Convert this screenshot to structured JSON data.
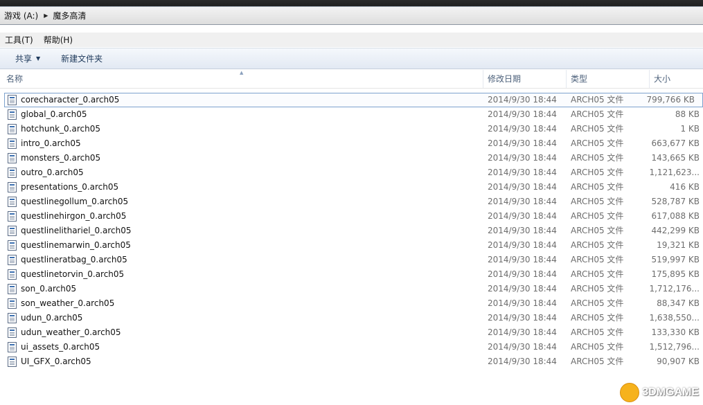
{
  "address_bar": {
    "crumbs": [
      "游戏 (A:)",
      "魔多高清"
    ],
    "separator": "▶"
  },
  "menu": {
    "items": [
      "工具(T)",
      "帮助(H)"
    ]
  },
  "toolbar": {
    "share_label": "共享",
    "share_caret": "▼",
    "new_folder_label": "新建文件夹"
  },
  "columns": {
    "name": "名称",
    "date": "修改日期",
    "type": "类型",
    "size": "大小",
    "sort_arrow": "▲"
  },
  "files": [
    {
      "name": "corecharacter_0.arch05",
      "date": "2014/9/30 18:44",
      "type": "ARCH05 文件",
      "size": "799,766 KB"
    },
    {
      "name": "global_0.arch05",
      "date": "2014/9/30 18:44",
      "type": "ARCH05 文件",
      "size": "88 KB"
    },
    {
      "name": "hotchunk_0.arch05",
      "date": "2014/9/30 18:44",
      "type": "ARCH05 文件",
      "size": "1 KB"
    },
    {
      "name": "intro_0.arch05",
      "date": "2014/9/30 18:44",
      "type": "ARCH05 文件",
      "size": "663,677 KB"
    },
    {
      "name": "monsters_0.arch05",
      "date": "2014/9/30 18:44",
      "type": "ARCH05 文件",
      "size": "143,665 KB"
    },
    {
      "name": "outro_0.arch05",
      "date": "2014/9/30 18:44",
      "type": "ARCH05 文件",
      "size": "1,121,623..."
    },
    {
      "name": "presentations_0.arch05",
      "date": "2014/9/30 18:44",
      "type": "ARCH05 文件",
      "size": "416 KB"
    },
    {
      "name": "questlinegollum_0.arch05",
      "date": "2014/9/30 18:44",
      "type": "ARCH05 文件",
      "size": "528,787 KB"
    },
    {
      "name": "questlinehirgon_0.arch05",
      "date": "2014/9/30 18:44",
      "type": "ARCH05 文件",
      "size": "617,088 KB"
    },
    {
      "name": "questlinelithariel_0.arch05",
      "date": "2014/9/30 18:44",
      "type": "ARCH05 文件",
      "size": "442,299 KB"
    },
    {
      "name": "questlinemarwin_0.arch05",
      "date": "2014/9/30 18:44",
      "type": "ARCH05 文件",
      "size": "19,321 KB"
    },
    {
      "name": "questlineratbag_0.arch05",
      "date": "2014/9/30 18:44",
      "type": "ARCH05 文件",
      "size": "519,997 KB"
    },
    {
      "name": "questlinetorvin_0.arch05",
      "date": "2014/9/30 18:44",
      "type": "ARCH05 文件",
      "size": "175,895 KB"
    },
    {
      "name": "son_0.arch05",
      "date": "2014/9/30 18:44",
      "type": "ARCH05 文件",
      "size": "1,712,176..."
    },
    {
      "name": "son_weather_0.arch05",
      "date": "2014/9/30 18:44",
      "type": "ARCH05 文件",
      "size": "88,347 KB"
    },
    {
      "name": "udun_0.arch05",
      "date": "2014/9/30 18:44",
      "type": "ARCH05 文件",
      "size": "1,638,550..."
    },
    {
      "name": "udun_weather_0.arch05",
      "date": "2014/9/30 18:44",
      "type": "ARCH05 文件",
      "size": "133,330 KB"
    },
    {
      "name": "ui_assets_0.arch05",
      "date": "2014/9/30 18:44",
      "type": "ARCH05 文件",
      "size": "1,512,796..."
    },
    {
      "name": "UI_GFX_0.arch05",
      "date": "2014/9/30 18:44",
      "type": "ARCH05 文件",
      "size": "90,907 KB"
    }
  ],
  "watermark": {
    "text": "3DMGAME"
  },
  "colors": {
    "header_text": "#4c607a",
    "toolbar_text": "#1e395b",
    "focus_outline": "#7da2ce",
    "secondary_text": "#6d6d6d"
  }
}
